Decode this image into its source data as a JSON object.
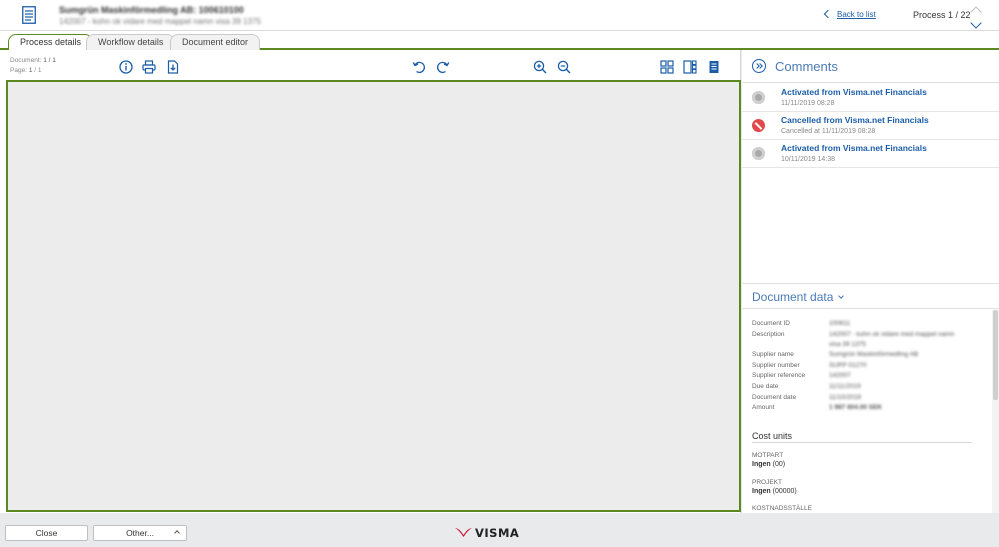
{
  "header": {
    "title": "Sumgrün Maskinförmedling AB: 100610100",
    "subtitle": "142007 - kohn ok vidare med mappel namn visa 39 1375",
    "back_label": "Back to list",
    "process_count": "Process 1 / 22"
  },
  "tabs": [
    {
      "label": "Process details",
      "active": true
    },
    {
      "label": "Workflow details",
      "active": false
    },
    {
      "label": "Document editor",
      "active": false
    }
  ],
  "viewer": {
    "document_label": "Document:",
    "document_value": "1 / 1",
    "page_label": "Page:",
    "page_value": "1",
    "page_total": "/ 1",
    "toolbar": [
      "info-icon",
      "print-icon",
      "download-pdf-icon",
      "rotate-left-icon",
      "rotate-right-icon",
      "zoom-in-icon",
      "zoom-out-icon",
      "grid-view-icon",
      "split-view-icon",
      "single-page-icon"
    ]
  },
  "comments": {
    "title": "Comments",
    "items": [
      {
        "title": "Activated from Visma.net Financials",
        "meta": "11/11/2019 08:28",
        "status": "gray"
      },
      {
        "title": "Cancelled from Visma.net Financials",
        "meta": "Cancelled at 11/11/2019 08:28",
        "status": "red"
      },
      {
        "title": "Activated from Visma.net Financials",
        "meta": "10/11/2019 14:38",
        "status": "gray"
      }
    ]
  },
  "document_data": {
    "title": "Document data",
    "fields": [
      {
        "label": "Document ID",
        "value": "100611"
      },
      {
        "label": "Description",
        "value": "142007 - kohn ok vidare med mappel namn"
      },
      {
        "label": "",
        "value": "visa 39 1375"
      },
      {
        "label": "Supplier name",
        "value": "Sumgrün Maskinförmedling AB"
      },
      {
        "label": "Supplier number",
        "value": "SUPP 01270"
      },
      {
        "label": "Supplier reference",
        "value": "142007"
      },
      {
        "label": "Due date",
        "value": "11/11/2019"
      },
      {
        "label": "Document date",
        "value": "11/10/2019"
      },
      {
        "label": "Amount",
        "value": "1 987 604.00 SEK"
      }
    ]
  },
  "cost_units": {
    "title": "Cost units",
    "items": [
      {
        "label": "MOTPART",
        "value": "Ingen",
        "code": "(00)"
      },
      {
        "label": "PROJEKT",
        "value": "Ingen",
        "code": "(00000)"
      },
      {
        "label": "KOSTNADSSTÄLLE",
        "value": "",
        "code": ""
      }
    ]
  },
  "footer": {
    "close_label": "Close",
    "other_label": "Other...",
    "logo_text": "VISMA"
  },
  "colors": {
    "accent_green": "#5a8a1f",
    "link_blue": "#1b5da8",
    "brand_red": "#c8102e"
  }
}
